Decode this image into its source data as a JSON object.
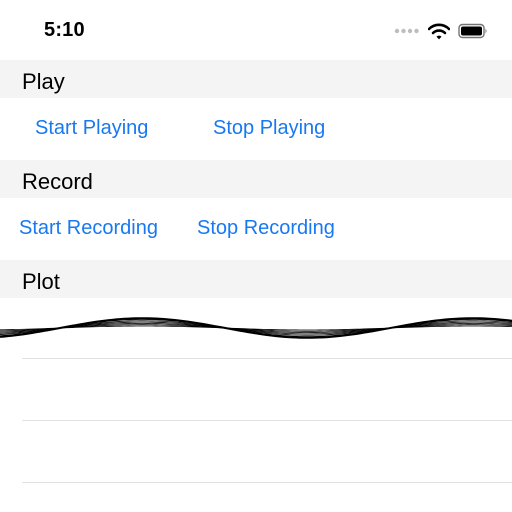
{
  "status_bar": {
    "time": "5:10",
    "icons": [
      "signal-dots-icon",
      "wifi-icon",
      "battery-icon"
    ]
  },
  "sections": {
    "play": {
      "title": "Play",
      "start_label": "Start Playing",
      "stop_label": "Stop Playing"
    },
    "record": {
      "title": "Record",
      "start_label": "Start Recording",
      "stop_label": "Stop Recording"
    },
    "plot": {
      "title": "Plot"
    }
  },
  "colors": {
    "accent": "#1878f2",
    "header_background": "#f4f4f4",
    "waveform": "#000000"
  }
}
